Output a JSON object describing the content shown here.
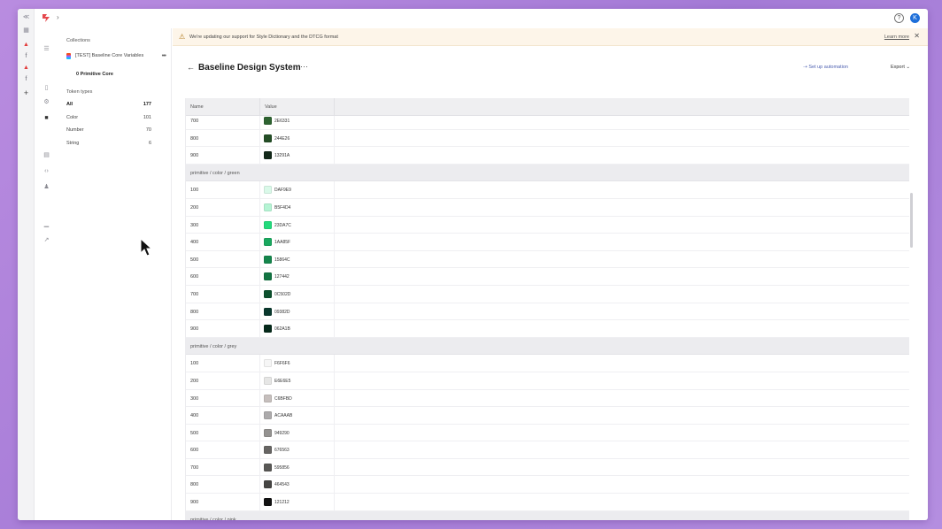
{
  "topbar": {
    "avatar_letter": "K",
    "help_glyph": "?"
  },
  "rail_icons": [
    "collapse-icon",
    "grid-icon",
    "figma-red-icon",
    "figma-icon",
    "figma-red-icon",
    "figma-icon",
    "plus-icon"
  ],
  "collections": {
    "label": "Collections",
    "item": "[TEST] Baseline Core Variables",
    "sub": "0 Primitive Core"
  },
  "token_types": {
    "label": "Token types",
    "items": [
      {
        "label": "All",
        "count": "177"
      },
      {
        "label": "Color",
        "count": "101"
      },
      {
        "label": "Number",
        "count": "70"
      },
      {
        "label": "String",
        "count": "6"
      }
    ]
  },
  "banner": {
    "message": "We're updating our support for Style Dictionary and the DTCG format",
    "link": "Learn more"
  },
  "page": {
    "title": "Baseline Design System",
    "automation": "Set up automation",
    "export": "Export"
  },
  "table": {
    "headers": [
      "Name",
      "Value"
    ],
    "rows": [
      {
        "type": "token",
        "name": "700",
        "value": "2E6331",
        "color": "#2E6331"
      },
      {
        "type": "token",
        "name": "800",
        "value": "244E26",
        "color": "#244E26"
      },
      {
        "type": "token",
        "name": "900",
        "value": "13291A",
        "color": "#13291A"
      },
      {
        "type": "group",
        "name": "primitive / color / green"
      },
      {
        "type": "token",
        "name": "100",
        "value": "DAF9E9",
        "color": "#DAF9E9"
      },
      {
        "type": "token",
        "name": "200",
        "value": "B5F4D4",
        "color": "#B5F4D4"
      },
      {
        "type": "token",
        "name": "300",
        "value": "23DA7C",
        "color": "#23DA7C"
      },
      {
        "type": "token",
        "name": "400",
        "value": "1AA85F",
        "color": "#1AA85F"
      },
      {
        "type": "token",
        "name": "500",
        "value": "15864C",
        "color": "#15864C"
      },
      {
        "type": "token",
        "name": "600",
        "value": "127442",
        "color": "#127442"
      },
      {
        "type": "token",
        "name": "700",
        "value": "0C502D",
        "color": "#0C502D"
      },
      {
        "type": "token",
        "name": "800",
        "value": "09382D",
        "color": "#09382D"
      },
      {
        "type": "token",
        "name": "900",
        "value": "062A1B",
        "color": "#062A1B"
      },
      {
        "type": "group",
        "name": "primitive / color / grey"
      },
      {
        "type": "token",
        "name": "100",
        "value": "F6F6F6",
        "color": "#F6F6F6"
      },
      {
        "type": "token",
        "name": "200",
        "value": "E6E6E5",
        "color": "#E6E6E5"
      },
      {
        "type": "token",
        "name": "300",
        "value": "C6BFBD",
        "color": "#C6BFBD"
      },
      {
        "type": "token",
        "name": "400",
        "value": "ACAAAB",
        "color": "#ACAAAB"
      },
      {
        "type": "token",
        "name": "500",
        "value": "949290",
        "color": "#949290"
      },
      {
        "type": "token",
        "name": "600",
        "value": "676563",
        "color": "#676563"
      },
      {
        "type": "token",
        "name": "700",
        "value": "595856",
        "color": "#595856"
      },
      {
        "type": "token",
        "name": "800",
        "value": "464543",
        "color": "#464543"
      },
      {
        "type": "token",
        "name": "900",
        "value": "121212",
        "color": "#121212"
      },
      {
        "type": "group",
        "name": "primitive / color / pink"
      }
    ]
  },
  "colors": {
    "accent": "#4c5fb0",
    "banner_bg": "#fdf5e9",
    "avatar": "#1e6fd9"
  }
}
